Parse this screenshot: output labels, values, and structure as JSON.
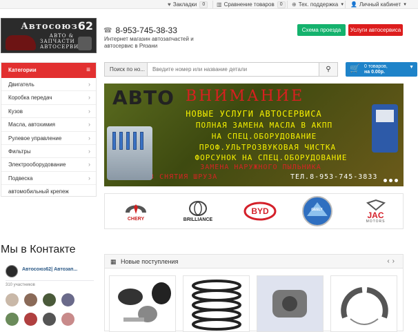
{
  "topbar": {
    "bookmarks_label": "Закладки",
    "bookmarks_count": "0",
    "compare_label": "Сравнение товаров",
    "compare_count": "0",
    "support_label": "Тех. поддержка",
    "account_label": "Личный кабинет"
  },
  "logo": {
    "number": "62",
    "line1": "Автосоюз",
    "line2": "АВТО &",
    "line3": "ЗАПЧАСТИ",
    "line4": "АВТОСЕРВИС"
  },
  "header": {
    "phone": "8-953-745-38-33",
    "tagline": "Интернет магазин автозапчастей и автосервис в Рязани",
    "route_button": "Схема проезда",
    "services_button": "Услуги автосервиса"
  },
  "search": {
    "select_label": "Поиск по но...",
    "placeholder": "Введите номер или название детали"
  },
  "cart": {
    "line1": "0 товаров,",
    "line2": "на 0.00р."
  },
  "sidebar": {
    "title": "Категории",
    "items": [
      {
        "label": "Двигатель"
      },
      {
        "label": "Коробка передач"
      },
      {
        "label": "Кузов"
      },
      {
        "label": "Масла, автохимия"
      },
      {
        "label": "Рулевое управление"
      },
      {
        "label": "Фильтры"
      },
      {
        "label": "Электрооборудование"
      },
      {
        "label": "Подвеска"
      },
      {
        "label": "автомобильный крепеж"
      }
    ]
  },
  "banner": {
    "avto": "АВТО",
    "heading": "ВНИМАНИЕ",
    "line1": "НОВЫЕ УСЛУГИ АВТОСЕРВИСА",
    "line2": "ПОЛНАЯ ЗАМЕНА МАСЛА В АКПП",
    "line3": "НА СПЕЦ.ОБОРУДОВАНИЕ",
    "line4": "ПРОФ.УЛЬТРОЗВУКОВАЯ ЧИСТКА",
    "line5": "ФОРСУНОК НА СПЕЦ.ОБОРУДОВАНИЕ",
    "line6": "ЗАМЕНА НАРУЖНОГО ПЫЛЬНИКА",
    "line7": "БЕЗ СНЯТИЯ ШРУЗА",
    "tel": "ТЕЛ.8-953-745-3833"
  },
  "brands": [
    {
      "name": "CHERY"
    },
    {
      "name": "BRILLIANCE"
    },
    {
      "name": "BYD"
    },
    {
      "name": "GEELY"
    },
    {
      "name": "JAC"
    }
  ],
  "brand_jac_sub": "MOTORS",
  "vk": {
    "title": "Мы в Контакте",
    "group_name": "Автосоюз62| Автозап...",
    "members": "310 участников"
  },
  "new_products": {
    "title": "Новые поступления"
  },
  "colors": {
    "red": "#dd1d1d",
    "green": "#14b26d",
    "blue": "#1e83c9"
  }
}
